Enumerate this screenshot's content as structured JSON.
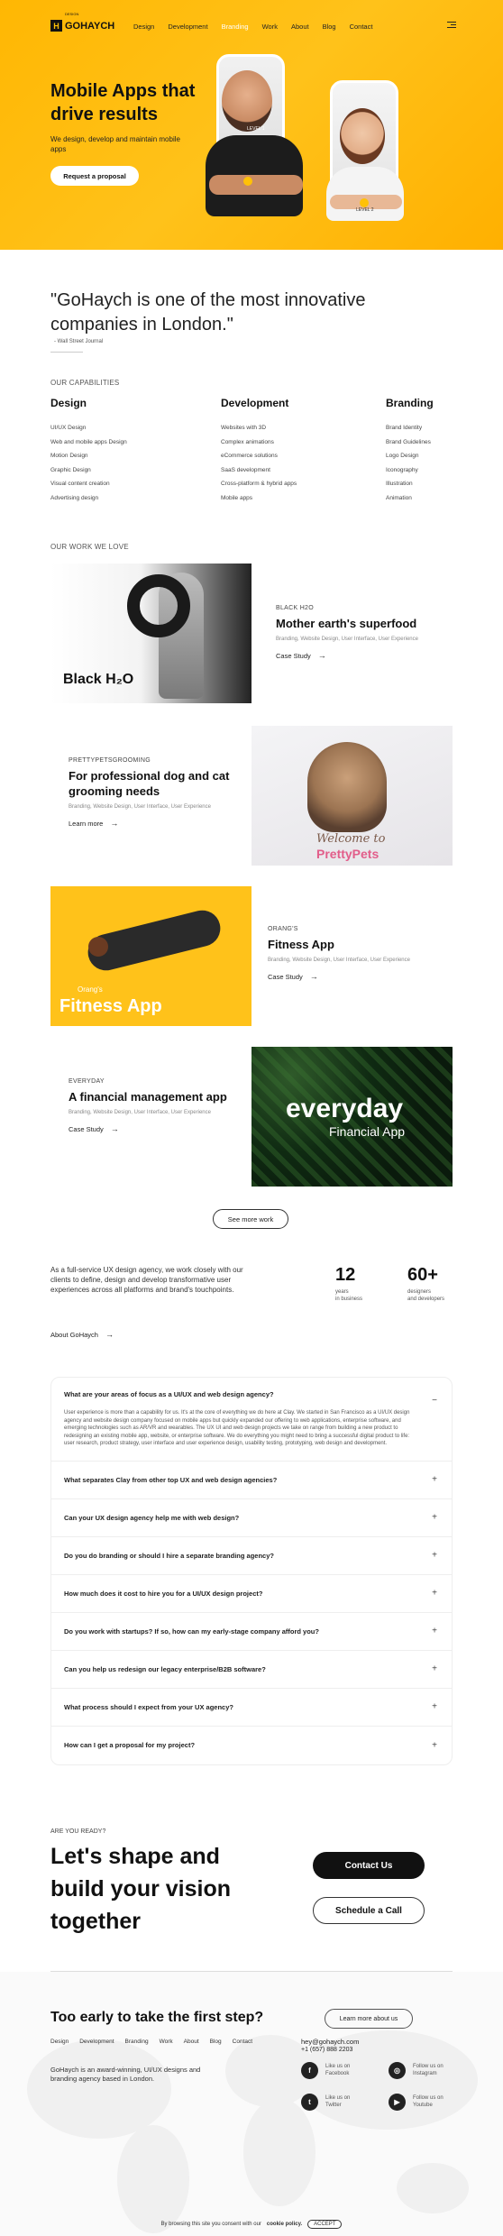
{
  "header": {
    "logo_mark": "H",
    "logo_text": "GOHAYCH",
    "logo_sub": "DESIGN",
    "nav": [
      "Design",
      "Development",
      "Branding",
      "Work",
      "About",
      "Blog",
      "Contact"
    ],
    "active_nav": "Branding"
  },
  "hero": {
    "title": "Mobile Apps that drive results",
    "subtitle": "We design, develop and maintain mobile apps",
    "cta": "Request a proposal",
    "phone1_tag": "LEVEL 1",
    "phone2_tag": "LEVEL 2"
  },
  "quote": {
    "text": "\"GoHaych is one of the most innovative companies in London.\"",
    "author": "- Wall Street Journal"
  },
  "capabilities": {
    "label": "OUR CAPABILITIES",
    "columns": [
      {
        "title": "Design",
        "items": [
          "UI/UX Design",
          "Web and mobile apps Design",
          "Motion Design",
          "Graphic Design",
          "Visual content creation",
          "Advertising design"
        ]
      },
      {
        "title": "Development",
        "items": [
          "Websites with 3D",
          "Complex animations",
          "eCommerce solutions",
          "SaaS development",
          "Cross-platform & hybrid apps",
          "Mobile apps"
        ]
      },
      {
        "title": "Branding",
        "items": [
          "Brand Identity",
          "Brand Guidelines",
          "Logo Design",
          "Iconography",
          "Illustration",
          "Animation"
        ]
      }
    ]
  },
  "work": {
    "label": "OUR WORK WE LOVE",
    "items": [
      {
        "tag": "BLACK H2O",
        "title": "Mother earth's superfood",
        "cats": "Branding, Website Design, User Interface, User Experience",
        "link": "Case Study",
        "art": "Black H₂O"
      },
      {
        "tag": "PRETTYPETSGROOMING",
        "title": "For professional dog and cat grooming needs",
        "cats": "Branding, Website Design, User Interface, User Experience",
        "link": "Learn more",
        "art1": "Welcome to",
        "art2": "PrettyPets"
      },
      {
        "tag": "ORANG'S",
        "title": "Fitness App",
        "cats": "Branding, Website Design, User Interface, User Experience",
        "link": "Case Study",
        "art1": "Orang's",
        "art2": "Fitness App"
      },
      {
        "tag": "EVERYDAY",
        "title": "A financial management app",
        "cats": "Branding, Website Design, User Interface, User Experience",
        "link": "Case Study",
        "art1": "everyday",
        "art2": "Financial App"
      }
    ],
    "see_more": "See more work"
  },
  "about": {
    "text": "As a full-service UX design agency, we work closely with our clients to define, design and develop transformative user experiences across all platforms and brand's touchpoints.",
    "stats": [
      {
        "num": "12",
        "cap1": "years",
        "cap2": "in business"
      },
      {
        "num": "60+",
        "cap1": "designers",
        "cap2": "and developers"
      }
    ],
    "link": "About GoHaych"
  },
  "faq": {
    "items": [
      {
        "q": "What are your areas of focus as a UI/UX and web design agency?",
        "a": "User experience is more than a capability for us. It's at the core of everything we do here at Clay. We started in San Francisco as a UI/UX design agency and website design company focused on mobile apps but quickly expanded our offering to web applications, enterprise software, and emerging technologies such as AR/VR and wearables. The UX UI and web design projects we take on range from building a new product to redesigning an existing mobile app, website, or enterprise software. We do everything you might need to bring a successful digital product to life: user research, product strategy, user interface and user experience design, usability testing, prototyping, web design and development.",
        "sign": "−"
      },
      {
        "q": "What separates Clay from other top UX and web design agencies?",
        "sign": "+"
      },
      {
        "q": "Can your UX design agency help me with web design?",
        "sign": "+"
      },
      {
        "q": "Do you do branding or should I hire a separate branding agency?",
        "sign": "+"
      },
      {
        "q": "How much does it cost to hire you for a UI/UX design project?",
        "sign": "+"
      },
      {
        "q": "Do you work with startups? If so, how can my early-stage company afford you?",
        "sign": "+"
      },
      {
        "q": "Can you help us redesign our legacy enterprise/B2B software?",
        "sign": "+"
      },
      {
        "q": "What process should I expect from your UX agency?",
        "sign": "+"
      },
      {
        "q": "How can I get a proposal for my project?",
        "sign": "+"
      }
    ]
  },
  "cta": {
    "label": "ARE YOU READY?",
    "title": "Let's shape and build your vision together",
    "btn1": "Contact Us",
    "btn2": "Schedule a Call"
  },
  "footer": {
    "early": "Too early to take the first step?",
    "learn": "Learn more about us",
    "nav": [
      "Design",
      "Development",
      "Branding",
      "Work",
      "About",
      "Blog",
      "Contact"
    ],
    "email": "hey@gohaych.com",
    "phone": "+1 (657) 888 2203",
    "desc": "GoHaych is an award-winning, UI/UX designs and branding agency based in London.",
    "social": [
      {
        "icon": "f",
        "line1": "Like us on",
        "line2": "Facebook"
      },
      {
        "icon": "◎",
        "line1": "Follow us on",
        "line2": "Instagram"
      },
      {
        "icon": "t",
        "line1": "Like us on",
        "line2": "Twitter"
      },
      {
        "icon": "▶",
        "line1": "Follow us on",
        "line2": "Youtube"
      }
    ],
    "cookie_text": "By browsing this site you consent with our",
    "cookie_link": "cookie policy.",
    "accept": "ACCEPT"
  }
}
